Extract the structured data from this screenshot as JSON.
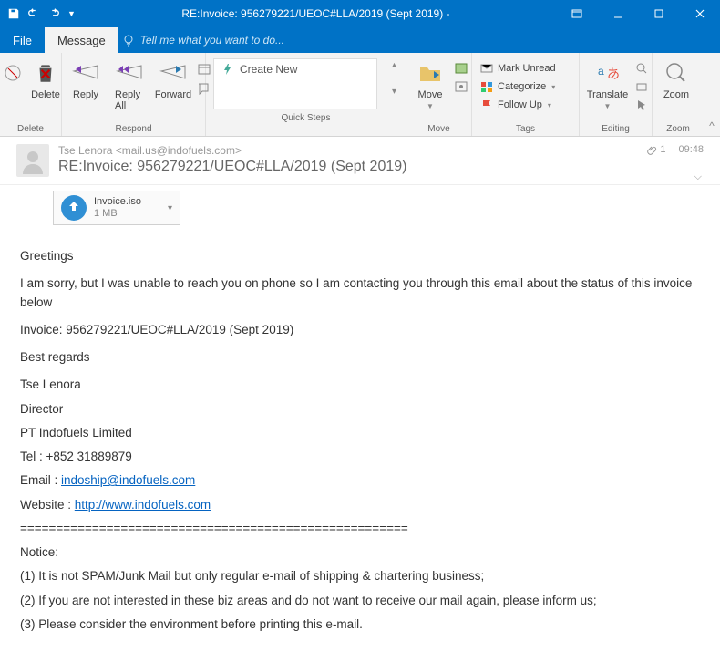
{
  "titlebar": {
    "title": "RE:Invoice: 956279221/UEOC#LLA/2019 (Sept 2019) -"
  },
  "menu": {
    "file": "File",
    "message": "Message",
    "tellme": "Tell me what you want to do..."
  },
  "ribbon": {
    "delete_group": "Delete",
    "delete": "Delete",
    "respond_group": "Respond",
    "reply": "Reply",
    "reply_all": "Reply All",
    "forward": "Forward",
    "quicksteps_group": "Quick Steps",
    "create_new": "Create New",
    "move_group": "Move",
    "move": "Move",
    "tags_group": "Tags",
    "mark_unread": "Mark Unread",
    "categorize": "Categorize",
    "follow_up": "Follow Up",
    "editing_group": "Editing",
    "translate": "Translate",
    "zoom_group": "Zoom",
    "zoom": "Zoom"
  },
  "header": {
    "from_name": "Tse Lenora",
    "from_email": "<mail.us@indofuels.com>",
    "subject": "RE:Invoice: 956279221/UEOC#LLA/2019 (Sept 2019)",
    "time": "09:48",
    "attach_count": "1"
  },
  "attachment": {
    "name": "Invoice.iso",
    "size": "1 MB"
  },
  "body": {
    "greeting": "Greetings",
    "line1": "I am sorry, but I was unable to reach you on phone so I am contacting you through this email about the status of this invoice below",
    "line2": "Invoice: 956279221/UEOC#LLA/2019 (Sept 2019)",
    "regards": "Best regards",
    "sig_name": "Tse Lenora",
    "sig_title": "Director",
    "sig_company": "PT Indofuels Limited",
    "sig_tel": "Tel : +852 31889879",
    "sig_email_label": "Email : ",
    "sig_email": "indoship@indofuels.com",
    "sig_web_label": "Website : ",
    "sig_web": "http://www.indofuels.com",
    "divider": "======================================================",
    "notice": "Notice:",
    "n1": "(1) It is not SPAM/Junk Mail but only regular e-mail of shipping & chartering business;",
    "n2": "(2) If you are not interested in these biz areas and do not want to receive our mail again, please inform us;",
    "n3": "(3) Please consider the environment before printing this e-mail."
  }
}
